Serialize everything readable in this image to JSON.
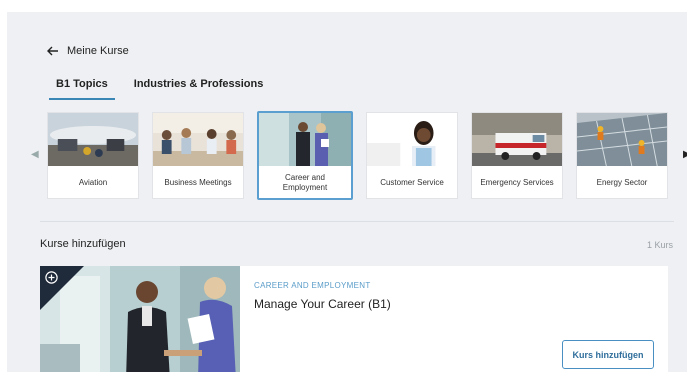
{
  "header": {
    "back_label": "Meine Kurse"
  },
  "tabs": [
    {
      "label": "B1 Topics",
      "active": true
    },
    {
      "label": "Industries & Professions",
      "active": false
    }
  ],
  "topics": [
    {
      "label": "Aviation"
    },
    {
      "label": "Business Meetings"
    },
    {
      "label": "Career and Employment",
      "selected": true
    },
    {
      "label": "Customer Service"
    },
    {
      "label": "Emergency Services"
    },
    {
      "label": "Energy Sector"
    }
  ],
  "section": {
    "title": "Kurse hinzufügen",
    "count": "1 Kurs"
  },
  "course": {
    "category": "CAREER AND EMPLOYMENT",
    "title": "Manage Your Career (B1)",
    "button_label": "Kurs hinzufügen"
  },
  "colors": {
    "accent": "#3a86b5",
    "selected_border": "#5b9fd0",
    "category": "#5a9cc9"
  },
  "icons": {
    "back": "arrow-left-icon",
    "prev": "chevron-left-icon",
    "next": "chevron-right-icon",
    "add": "plus-circle-icon"
  }
}
